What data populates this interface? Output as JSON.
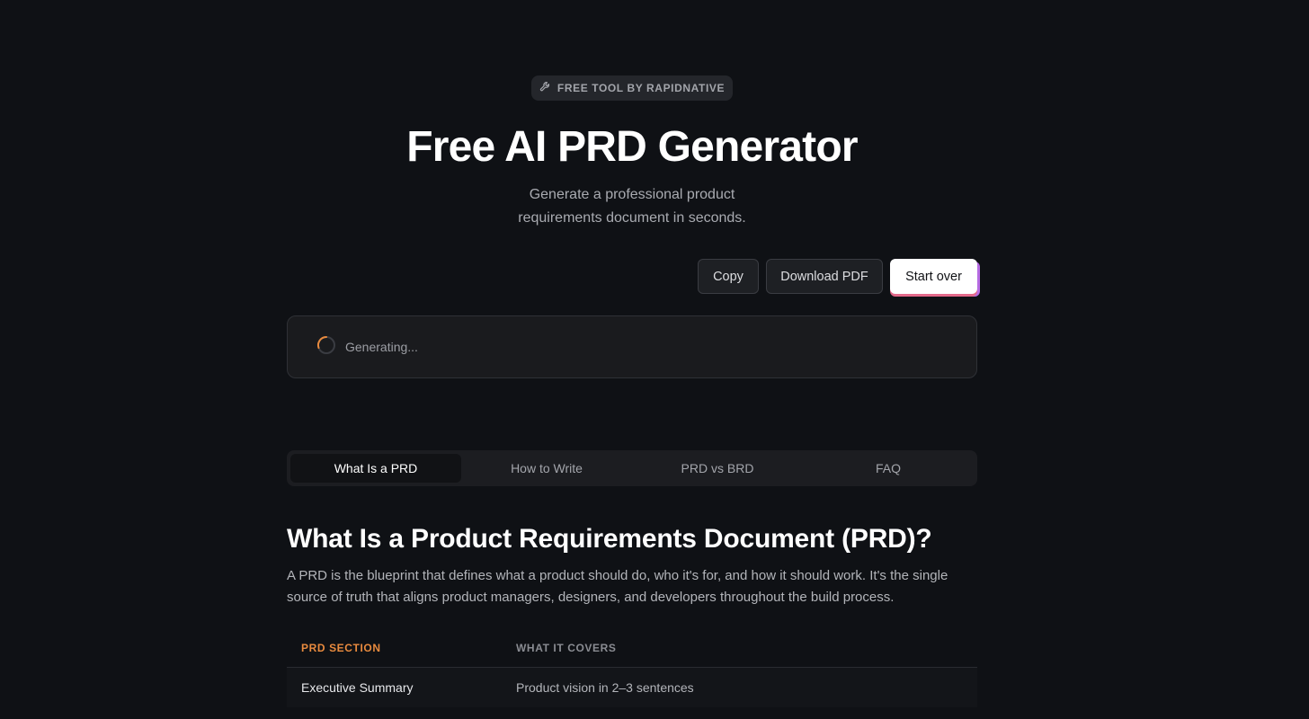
{
  "badge": {
    "text": "FREE TOOL BY RAPIDNATIVE",
    "icon": "wrench-icon"
  },
  "hero": {
    "title": "Free AI PRD Generator",
    "subtitle": "Generate a professional product requirements document in seconds."
  },
  "actions": {
    "copy_label": "Copy",
    "download_label": "Download PDF",
    "start_over_label": "Start over"
  },
  "status": {
    "text": "Generating...",
    "icon": "spinner-icon",
    "accent": "#e88a3e"
  },
  "tabs": [
    {
      "label": "What Is a PRD",
      "active": true
    },
    {
      "label": "How to Write",
      "active": false
    },
    {
      "label": "PRD vs BRD",
      "active": false
    },
    {
      "label": "FAQ",
      "active": false
    }
  ],
  "section": {
    "title": "What Is a Product Requirements Document (PRD)?",
    "body": "A PRD is the blueprint that defines what a product should do, who it's for, and how it should work. It's the single source of truth that aligns product managers, designers, and developers throughout the build process."
  },
  "table": {
    "headers": [
      "PRD SECTION",
      "WHAT IT COVERS"
    ],
    "rows": [
      [
        "Executive Summary",
        "Product vision in 2–3 sentences"
      ]
    ]
  },
  "colors": {
    "background": "#0f1115",
    "accent": "#e88a3e",
    "button_primary": "#ffffff"
  }
}
